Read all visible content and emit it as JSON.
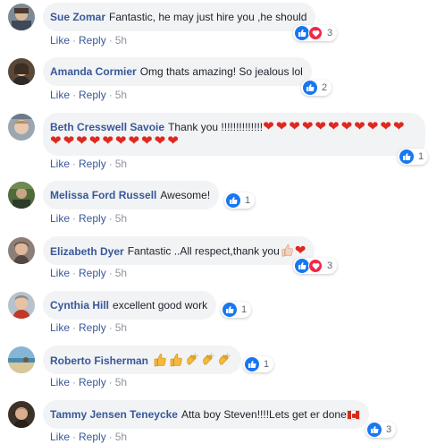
{
  "actions": {
    "like": "Like",
    "reply": "Reply",
    "separator": "·"
  },
  "colors": {
    "link": "#385898",
    "bubble": "#f2f3f5",
    "like_blue": "#1877f2",
    "love_red": "#f0284a",
    "heart": "#e0281f"
  },
  "comments": [
    {
      "author": "Sue Zomar",
      "text": "Fantastic, he may just hire you ,he should",
      "time": "5h",
      "reactions": [
        "like",
        "love"
      ],
      "reaction_count": "3"
    },
    {
      "author": "Amanda Cormier",
      "text": "Omg thats amazing! So jealous lol",
      "time": "5h",
      "reactions": [
        "like"
      ],
      "reaction_count": "2"
    },
    {
      "author": "Beth Cresswell Savoie",
      "text": "Thank you !!!!!!!!!!!!!!",
      "emoji": "heart",
      "emoji_count": 21,
      "time": "5h",
      "reactions": [
        "like"
      ],
      "reaction_count": "1"
    },
    {
      "author": "Melissa Ford Russell",
      "text": "Awesome!",
      "time": "5h",
      "reactions": [
        "like"
      ],
      "reaction_count": "1"
    },
    {
      "author": "Elizabeth Dyer",
      "text": "Fantastic ..All respect,thank you",
      "emoji": "thumbs-up, heart",
      "time": "5h",
      "reactions": [
        "like",
        "love"
      ],
      "reaction_count": "3"
    },
    {
      "author": "Cynthia Hill",
      "text": "excellent good work",
      "time": "5h",
      "reactions": [
        "like"
      ],
      "reaction_count": "1"
    },
    {
      "author": "Roberto Fisherman",
      "text": "",
      "emoji": "2 thumbs-up, 3 clapping hands",
      "time": "5h",
      "reactions": [
        "like"
      ],
      "reaction_count": "1"
    },
    {
      "author": "Tammy Jensen Teneycke",
      "text": "Atta boy Steven!!!!Lets get er done",
      "emoji": "canada-flag",
      "time": "5h",
      "reactions": [
        "like"
      ],
      "reaction_count": "3"
    }
  ],
  "avatars": [
    "avatar-icon",
    "avatar-icon",
    "avatar-icon",
    "avatar-icon",
    "avatar-icon",
    "avatar-icon",
    "avatar-icon",
    "avatar-icon"
  ]
}
